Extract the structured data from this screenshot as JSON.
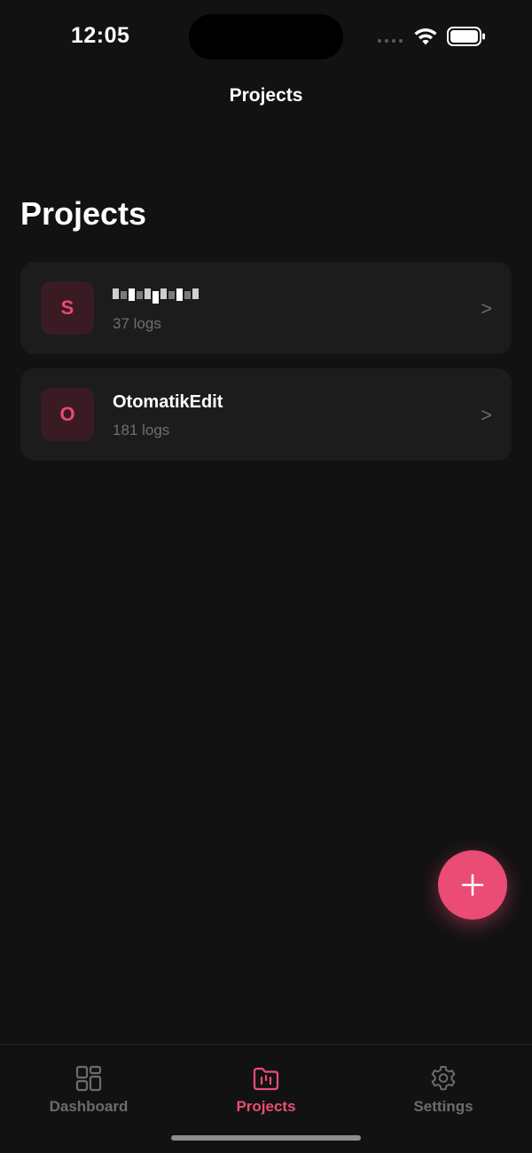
{
  "status_bar": {
    "time": "12:05"
  },
  "nav": {
    "title": "Projects"
  },
  "page": {
    "title": "Projects"
  },
  "projects": [
    {
      "initial": "S",
      "name": "",
      "name_redacted": true,
      "logs": "37 logs"
    },
    {
      "initial": "O",
      "name": "OtomatikEdit",
      "name_redacted": false,
      "logs": "181 logs"
    }
  ],
  "chevron": ">",
  "fab": {
    "icon": "plus-icon"
  },
  "tabs": [
    {
      "label": "Dashboard",
      "icon": "dashboard-icon",
      "active": false
    },
    {
      "label": "Projects",
      "icon": "folder-icon",
      "active": true
    },
    {
      "label": "Settings",
      "icon": "gear-icon",
      "active": false
    }
  ],
  "colors": {
    "accent": "#ea4c75",
    "background": "#121212",
    "card": "#1c1c1c",
    "muted_text": "#6f6f6f"
  }
}
